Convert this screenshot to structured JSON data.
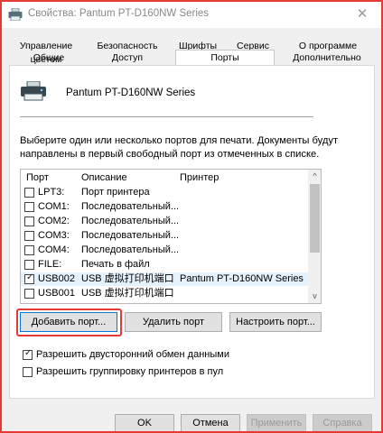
{
  "window": {
    "title": "Свойства: Pantum PT-D160NW Series",
    "close_glyph": "✕"
  },
  "tabs_row1": [
    "Управление цветом",
    "Безопасность",
    "Шрифты",
    "Сервис",
    "О программе"
  ],
  "tabs_row2": [
    "Общие",
    "Доступ",
    "Порты",
    "Дополнительно"
  ],
  "active_tab": "Порты",
  "printer": {
    "name": "Pantum PT-D160NW Series",
    "icon": "printer-icon"
  },
  "description": "Выберите один или несколько портов для печати. Документы будут направлены в первый свободный порт из отмеченных в списке.",
  "ports_table": {
    "headers": [
      "Порт",
      "Описание",
      "Принтер"
    ],
    "rows": [
      {
        "port": "LPT3:",
        "description": "Порт принтера",
        "printer": "",
        "checked": false,
        "selected": false
      },
      {
        "port": "COM1:",
        "description": "Последовательный...",
        "printer": "",
        "checked": false,
        "selected": false
      },
      {
        "port": "COM2:",
        "description": "Последовательный...",
        "printer": "",
        "checked": false,
        "selected": false
      },
      {
        "port": "COM3:",
        "description": "Последовательный...",
        "printer": "",
        "checked": false,
        "selected": false
      },
      {
        "port": "COM4:",
        "description": "Последовательный...",
        "printer": "",
        "checked": false,
        "selected": false
      },
      {
        "port": "FILE:",
        "description": "Печать в файл",
        "printer": "",
        "checked": false,
        "selected": false
      },
      {
        "port": "USB002",
        "description": "USB 虚拟打印机端口",
        "printer": "Pantum PT-D160NW Series",
        "checked": true,
        "selected": true
      },
      {
        "port": "USB001",
        "description": "USB 虚拟打印机端口",
        "printer": "",
        "checked": false,
        "selected": false
      }
    ],
    "scroll_up": "^",
    "scroll_down": "v"
  },
  "port_buttons": {
    "add": "Добавить порт...",
    "delete": "Удалить порт",
    "configure": "Настроить порт..."
  },
  "options": [
    {
      "label": "Разрешить двусторонний обмен данными",
      "checked": true
    },
    {
      "label": "Разрешить группировку принтеров в пул",
      "checked": false
    }
  ],
  "dialog_buttons": {
    "ok": "OK",
    "cancel": "Отмена",
    "apply": "Применить",
    "help": "Справка"
  },
  "colors": {
    "highlight_red": "#e53935",
    "selected_row": "#e5f1fb",
    "focus_blue": "#0078d7"
  }
}
